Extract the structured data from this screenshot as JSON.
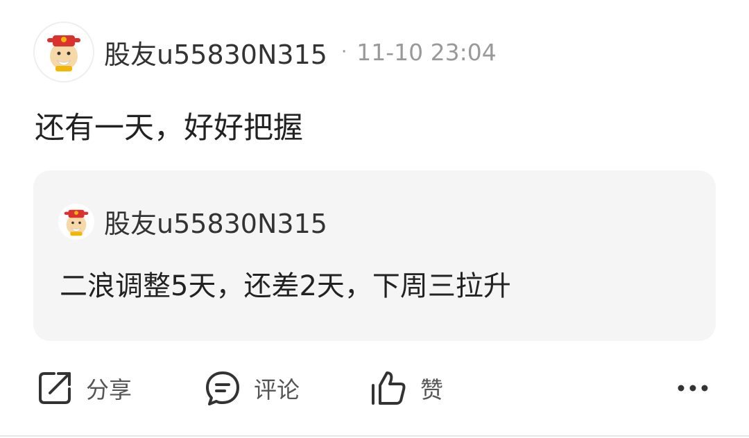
{
  "post": {
    "author": "股友u55830N315",
    "separator": "·",
    "timestamp": "11-10 23:04",
    "content": "还有一天，好好把握",
    "avatar_icon": "god-of-wealth-avatar-icon"
  },
  "quote": {
    "author": "股友u55830N315",
    "content": "二浪调整5天，还差2天，下周三拉升",
    "avatar_icon": "god-of-wealth-avatar-icon"
  },
  "actions": {
    "share_label": "分享",
    "comment_label": "评论",
    "like_label": "赞",
    "share_icon": "share-icon",
    "comment_icon": "comment-icon",
    "like_icon": "thumbs-up-icon",
    "more_icon": "more-icon"
  },
  "colors": {
    "quote_background": "#f5f5f6",
    "secondary_text": "#999999",
    "icon": "#333333"
  }
}
